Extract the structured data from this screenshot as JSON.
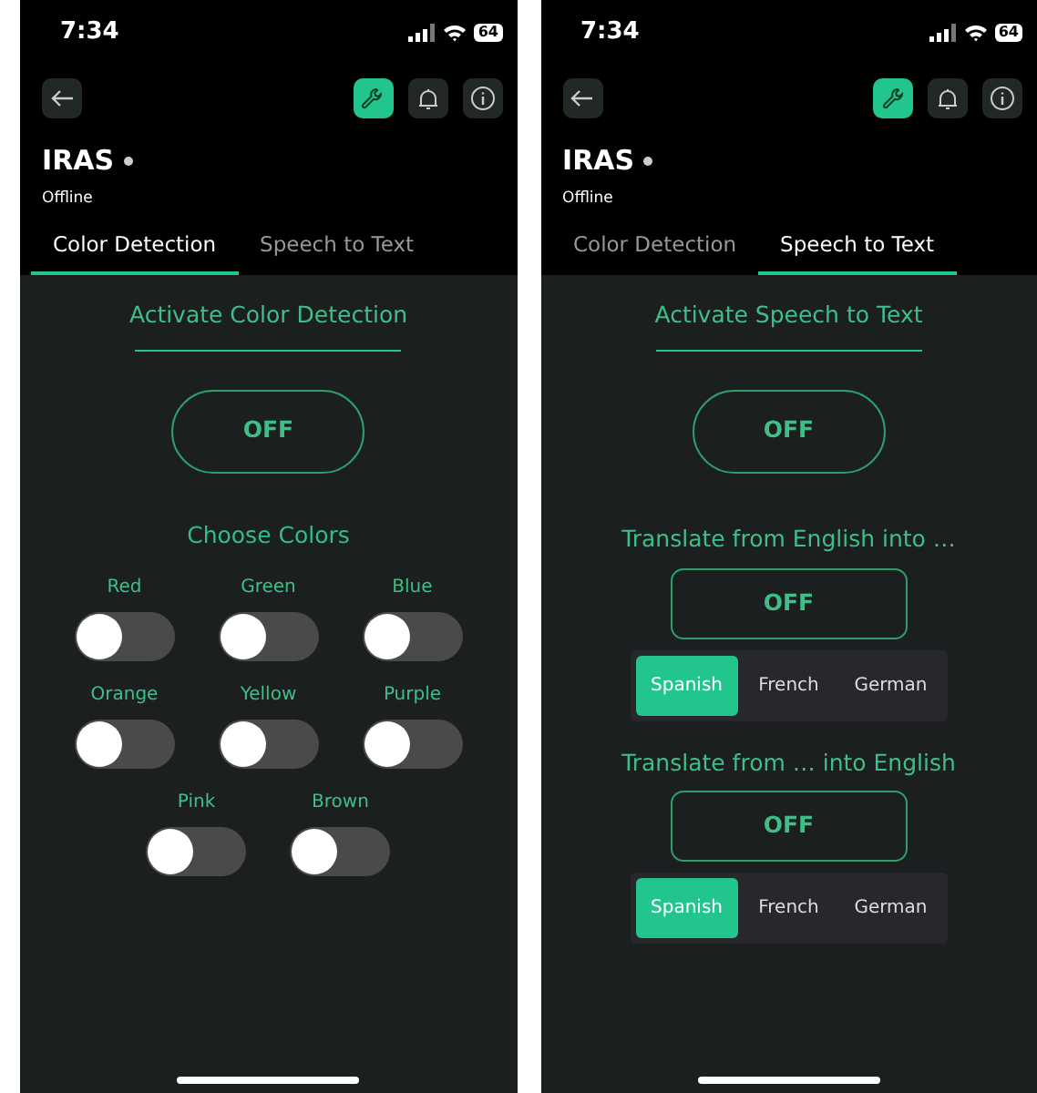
{
  "screens": [
    {
      "status_bar": {
        "time": "7:34",
        "battery": "64"
      },
      "title": "IRAS",
      "connection": "Offline",
      "tabs": [
        {
          "label": "Color Detection",
          "selected": true
        },
        {
          "label": "Speech to Text",
          "selected": false
        }
      ],
      "content": {
        "kind": "color_detection",
        "heading": "Activate Color Detection",
        "power_button": {
          "label": "OFF",
          "on": false
        },
        "section_title": "Choose Colors",
        "toggle_rows": [
          [
            {
              "label": "Red",
              "on": false
            },
            {
              "label": "Green",
              "on": false
            },
            {
              "label": "Blue",
              "on": false
            }
          ],
          [
            {
              "label": "Orange",
              "on": false
            },
            {
              "label": "Yellow",
              "on": false
            },
            {
              "label": "Purple",
              "on": false
            }
          ],
          [
            {
              "label": "Pink",
              "on": false
            },
            {
              "label": "Brown",
              "on": false
            }
          ]
        ]
      }
    },
    {
      "status_bar": {
        "time": "7:34",
        "battery": "64"
      },
      "title": "IRAS",
      "connection": "Offline",
      "tabs": [
        {
          "label": "Color Detection",
          "selected": false
        },
        {
          "label": "Speech to Text",
          "selected": true
        }
      ],
      "content": {
        "kind": "speech_to_text",
        "heading": "Activate Speech to Text",
        "power_button": {
          "label": "OFF",
          "on": false
        },
        "translations": [
          {
            "heading": "Translate from English into …",
            "button": {
              "label": "OFF",
              "on": false
            },
            "languages": [
              {
                "label": "Spanish",
                "selected": true
              },
              {
                "label": "French",
                "selected": false
              },
              {
                "label": "German",
                "selected": false
              }
            ]
          },
          {
            "heading": "Translate from … into English",
            "button": {
              "label": "OFF",
              "on": false
            },
            "languages": [
              {
                "label": "Spanish",
                "selected": true
              },
              {
                "label": "French",
                "selected": false
              },
              {
                "label": "German",
                "selected": false
              }
            ]
          }
        ]
      }
    }
  ]
}
